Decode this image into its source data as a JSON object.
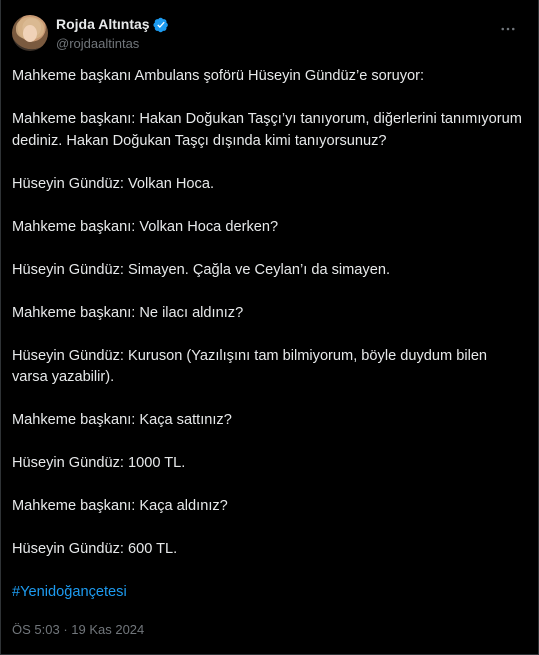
{
  "author": {
    "display_name": "Rojda Altıntaş",
    "handle": "@rojdaaltintas",
    "verified": true
  },
  "icons": {
    "verified_badge": "verified-badge-icon",
    "more": "more-horizontal-icon"
  },
  "colors": {
    "background": "#000000",
    "text": "#e7e9ea",
    "secondary": "#71767b",
    "accent": "#1d9bf0"
  },
  "tweet": {
    "paragraphs": [
      "Mahkeme başkanı Ambulans şoförü Hüseyin Gündüz’e soruyor:",
      "Mahkeme başkanı: Hakan Doğukan Taşçı’yı tanıyorum, diğerlerini tanımıyorum dediniz. Hakan Doğukan Taşçı dışında kimi tanıyorsunuz?",
      "Hüseyin Gündüz: Volkan Hoca.",
      "Mahkeme başkanı: Volkan Hoca derken?",
      "Hüseyin Gündüz: Simayen. Çağla ve Ceylan’ı da simayen.",
      "Mahkeme başkanı: Ne ilacı aldınız?",
      "Hüseyin Gündüz: Kuruson (Yazılışını tam bilmiyorum, böyle duydum bilen varsa yazabilir).",
      "Mahkeme başkanı: Kaça sattınız?",
      "Hüseyin Gündüz: 1000 TL.",
      "Mahkeme başkanı: Kaça aldınız?",
      "Hüseyin Gündüz: 600 TL."
    ],
    "hashtag": "#Yenidoğançetesi",
    "time": "ÖS 5:03",
    "separator": " · ",
    "date": "19 Kas 2024"
  }
}
